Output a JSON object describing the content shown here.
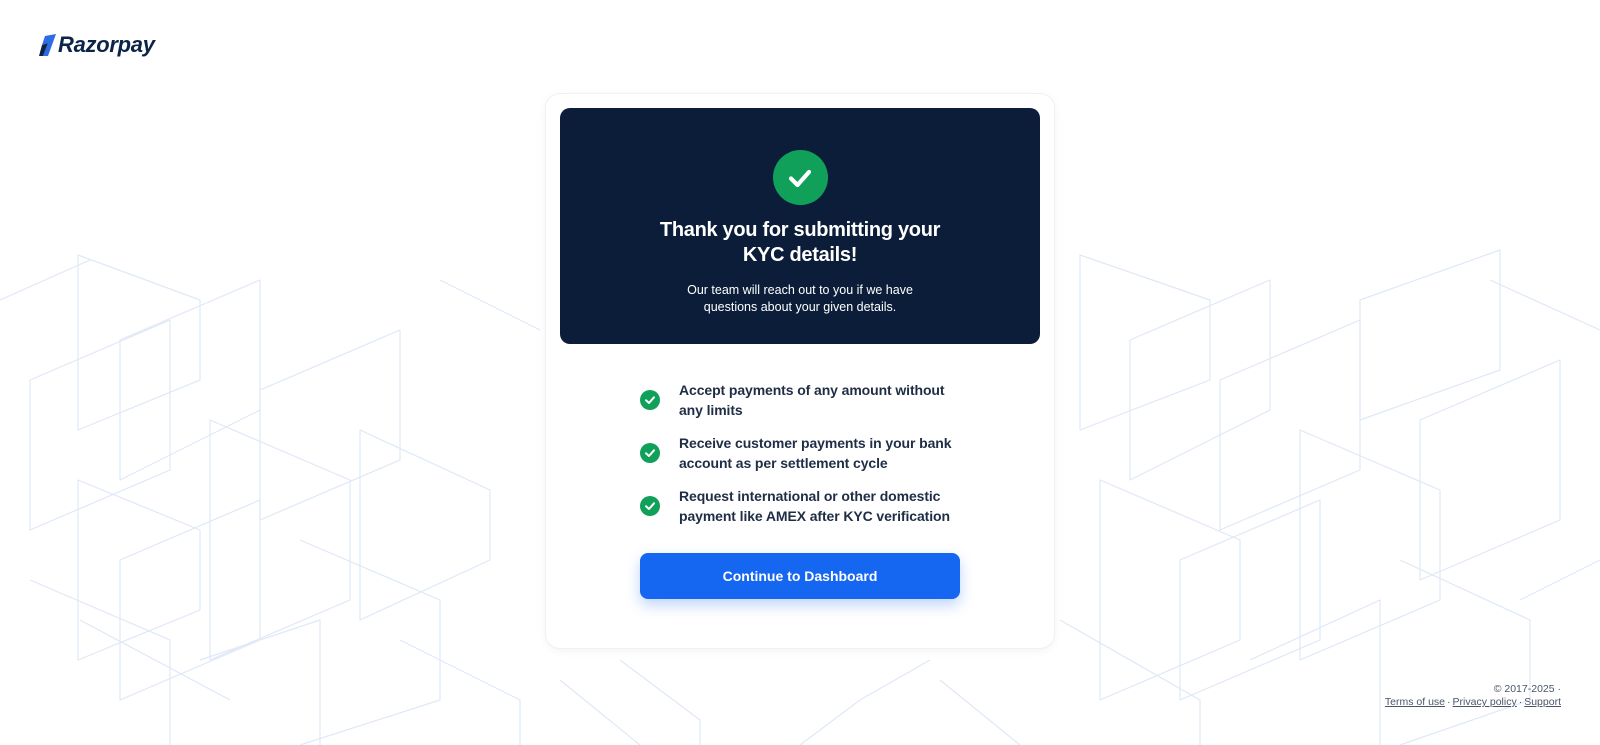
{
  "brand": {
    "name": "Razorpay",
    "logo_color": "#2e6be6"
  },
  "hero": {
    "icon": "check-circle-icon",
    "title": "Thank you for submitting your KYC details!",
    "subtitle": "Our team will reach out to you if we have questions about your given details.",
    "background": "#0b1d38",
    "icon_color": "#11a05a"
  },
  "features": [
    {
      "icon": "check-circle-icon",
      "text": "Accept payments of any amount without any limits"
    },
    {
      "icon": "check-circle-icon",
      "text": "Receive customer payments in your bank account as per settlement cycle"
    },
    {
      "icon": "check-circle-icon",
      "text": "Request international or other domestic payment like AMEX after KYC verification"
    }
  ],
  "cta": {
    "label": "Continue to Dashboard",
    "color": "#1566f1"
  },
  "footer": {
    "copyright": "© 2017-2025 ·",
    "links": {
      "terms": "Terms of use",
      "privacy": "Privacy policy",
      "support": "Support"
    },
    "separator": "·"
  }
}
